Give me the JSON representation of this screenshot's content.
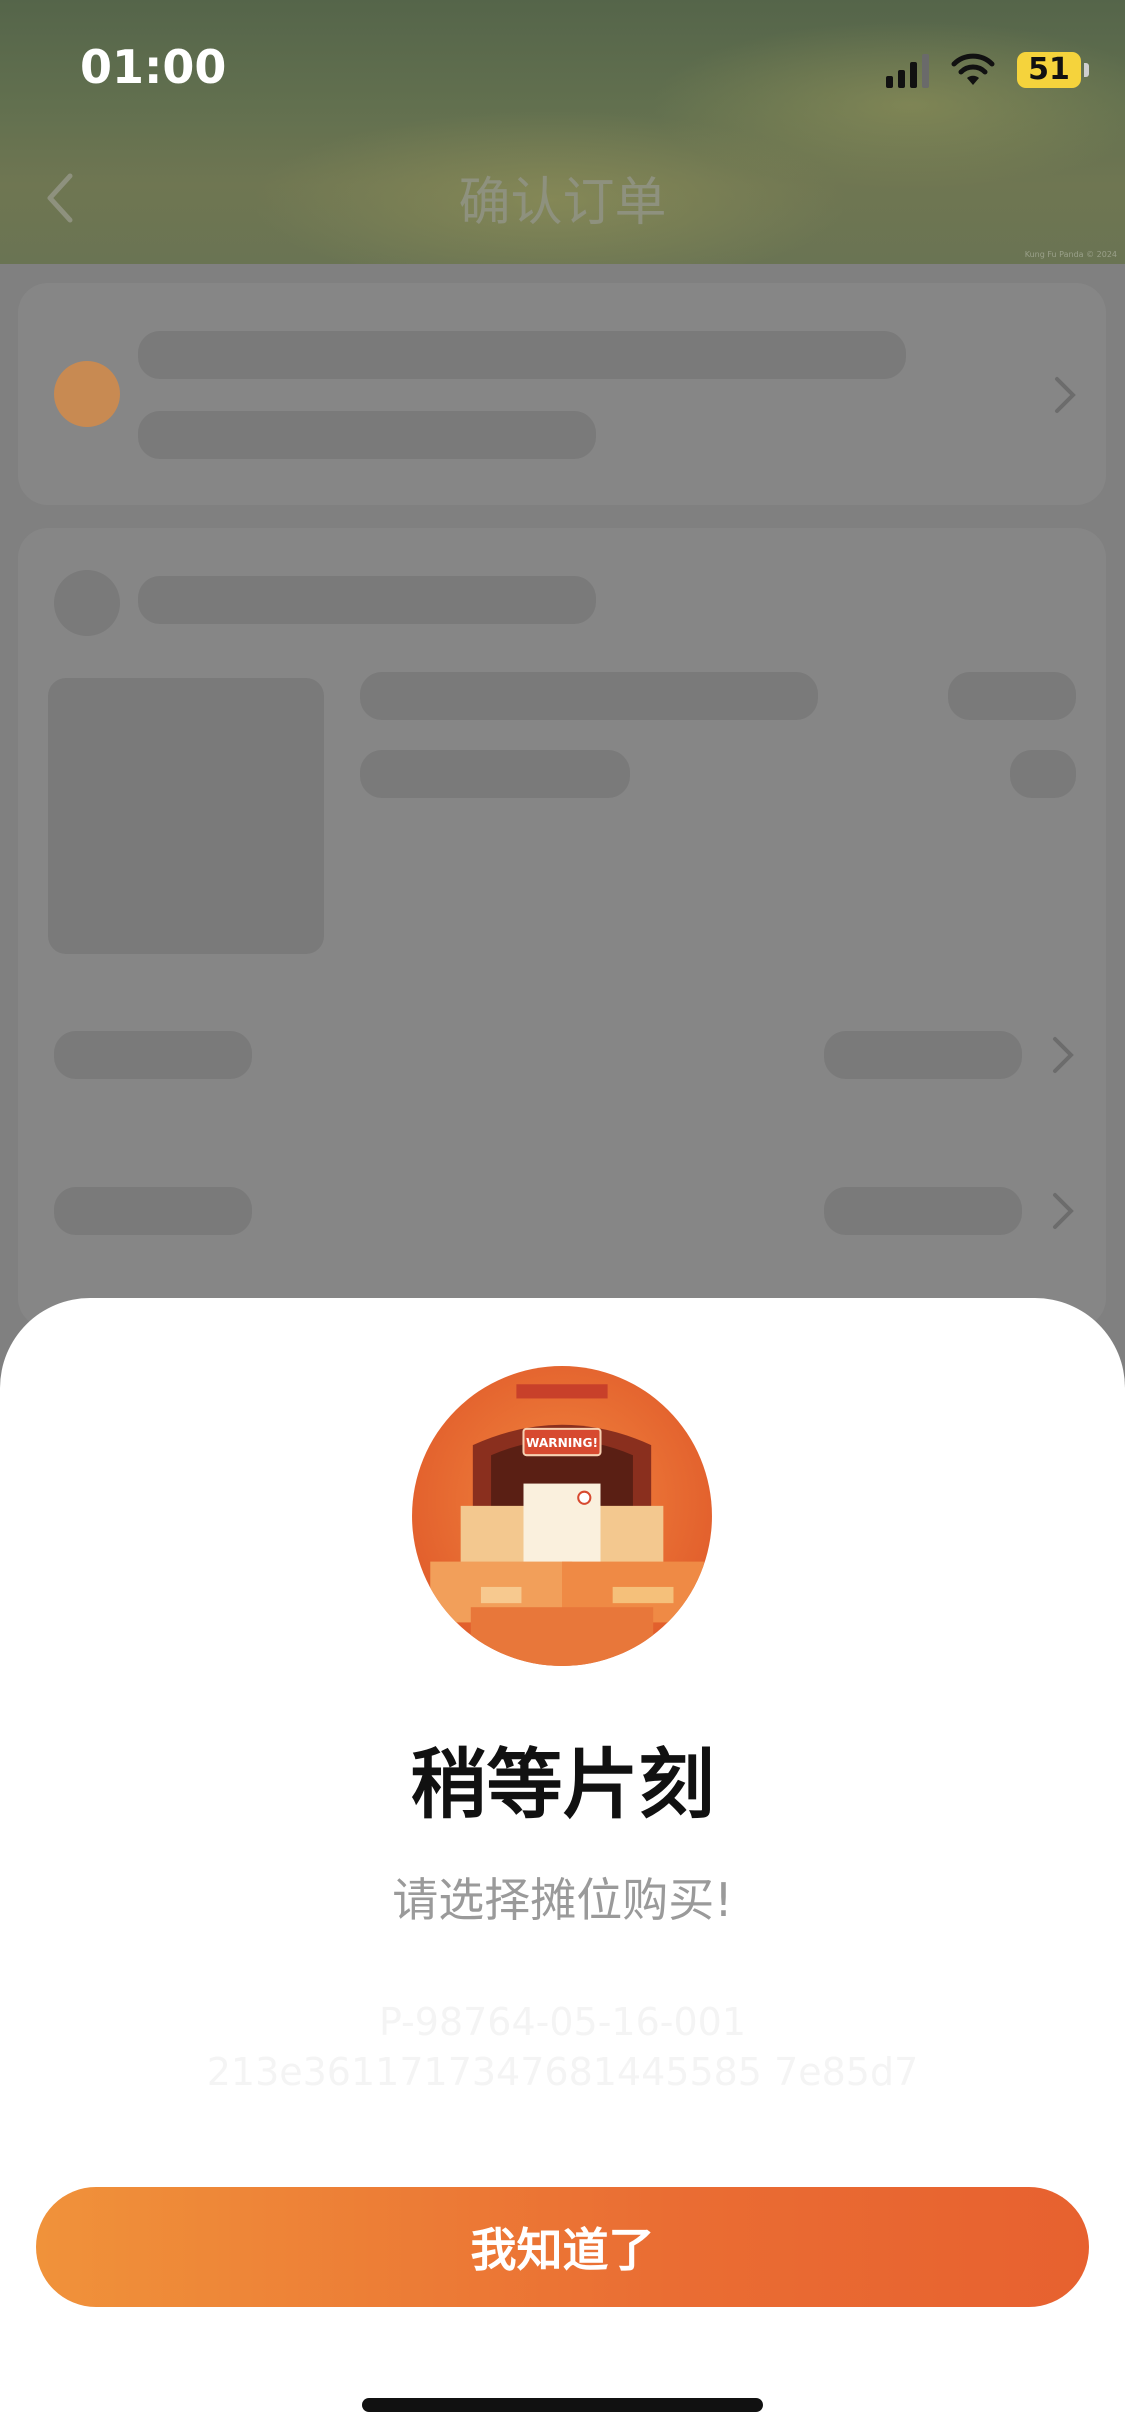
{
  "status_bar": {
    "time": "01:00",
    "battery": "51"
  },
  "header": {
    "title": "确认订单",
    "watermark": "Kung Fu Panda © 2024"
  },
  "illustration": {
    "sign_text": "WARNING!"
  },
  "dialog": {
    "title": "稍等片刻",
    "message": "请选择摊位购买!",
    "trace_line1": "P-98764-05-16-001",
    "trace_line2": "213e3611717347681445585 7e85d7",
    "button_label": "我知道了"
  },
  "colors": {
    "accent_start": "#f0923a",
    "accent_end": "#e7612f",
    "skeleton": "#7a7a7a",
    "avatar": "#c88a52"
  },
  "icons": [
    "back-icon",
    "chevron-right-icon",
    "signal-icon",
    "wifi-icon",
    "battery-icon"
  ]
}
